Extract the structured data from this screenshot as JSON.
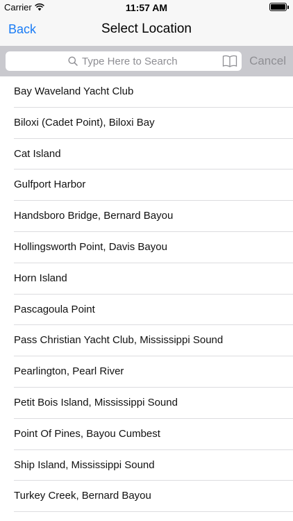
{
  "status_bar": {
    "carrier": "Carrier",
    "time": "11:57 AM"
  },
  "nav": {
    "back_label": "Back",
    "title": "Select Location"
  },
  "search": {
    "placeholder": "Type Here to Search",
    "cancel_label": "Cancel"
  },
  "colors": {
    "accent": "#1a7cf5",
    "search_bar_bg": "#c9c9ce",
    "separator": "#dcdcdf"
  },
  "locations": [
    "Bay Waveland Yacht Club",
    "Biloxi (Cadet Point), Biloxi Bay",
    "Cat Island",
    "Gulfport Harbor",
    "Handsboro Bridge, Bernard Bayou",
    "Hollingsworth Point, Davis Bayou",
    "Horn Island",
    "Pascagoula Point",
    "Pass Christian Yacht Club, Mississippi Sound",
    "Pearlington, Pearl River",
    "Petit Bois Island, Mississippi Sound",
    "Point Of Pines, Bayou Cumbest",
    "Ship Island, Mississippi Sound",
    "Turkey Creek, Bernard Bayou"
  ]
}
